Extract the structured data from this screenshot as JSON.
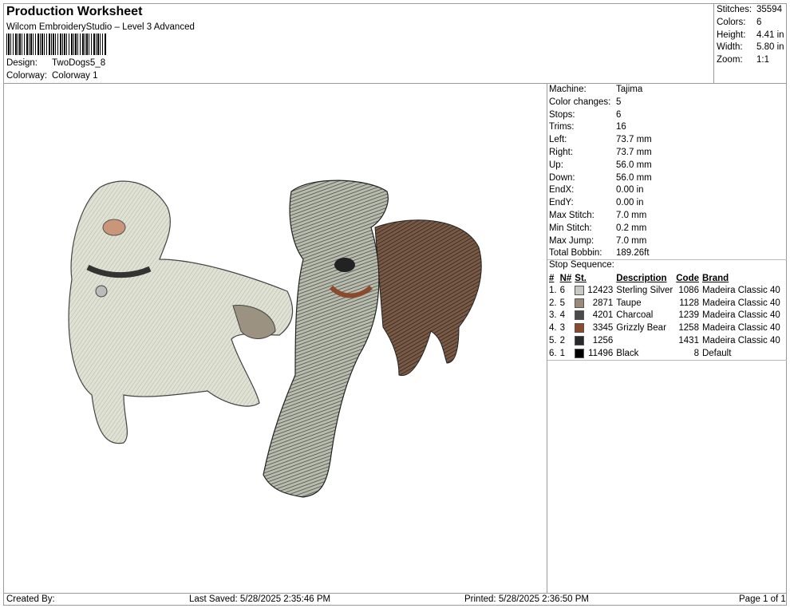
{
  "header": {
    "title": "Production Worksheet",
    "software": "Wilcom EmbroideryStudio – Level 3 Advanced",
    "design_label": "Design:",
    "design_value": "TwoDogs5_8",
    "colorway_label": "Colorway:",
    "colorway_value": "Colorway 1"
  },
  "summary": {
    "stitches_label": "Stitches:",
    "stitches_value": "35594",
    "colors_label": "Colors:",
    "colors_value": "6",
    "height_label": "Height:",
    "height_value": "4.41 in",
    "width_label": "Width:",
    "width_value": "5.80 in",
    "zoom_label": "Zoom:",
    "zoom_value": "1:1"
  },
  "machine_info": [
    {
      "label": "Machine:",
      "value": "Tajima"
    },
    {
      "label": "Color changes:",
      "value": "5"
    },
    {
      "label": "Stops:",
      "value": "6"
    },
    {
      "label": "Trims:",
      "value": "16"
    },
    {
      "label": "Left:",
      "value": "73.7 mm"
    },
    {
      "label": "Right:",
      "value": "73.7 mm"
    },
    {
      "label": "Up:",
      "value": "56.0 mm"
    },
    {
      "label": "Down:",
      "value": "56.0 mm"
    },
    {
      "label": "EndX:",
      "value": "0.00 in"
    },
    {
      "label": "EndY:",
      "value": "0.00 in"
    },
    {
      "label": "Max Stitch:",
      "value": "7.0 mm"
    },
    {
      "label": "Min Stitch:",
      "value": "0.2 mm"
    },
    {
      "label": "Max Jump:",
      "value": "7.0 mm"
    },
    {
      "label": "Total Bobbin:",
      "value": "189.26ft"
    }
  ],
  "stop_sequence": {
    "heading": "Stop Sequence:",
    "columns": [
      "#",
      "N#",
      "St.",
      "Description",
      "Code",
      "Brand"
    ],
    "rows": [
      {
        "idx": "1.",
        "n": "6",
        "color": "#c9c9c4",
        "st": "12423",
        "desc": "Sterling Silver",
        "code": "1086",
        "brand": "Madeira Classic 40"
      },
      {
        "idx": "2.",
        "n": "5",
        "color": "#9c8a78",
        "st": "2871",
        "desc": "Taupe",
        "code": "1128",
        "brand": "Madeira Classic 40"
      },
      {
        "idx": "3.",
        "n": "4",
        "color": "#4a4a4a",
        "st": "4201",
        "desc": "Charcoal",
        "code": "1239",
        "brand": "Madeira Classic 40"
      },
      {
        "idx": "4.",
        "n": "3",
        "color": "#8b4a2e",
        "st": "3345",
        "desc": "Grizzly Bear",
        "code": "1258",
        "brand": "Madeira Classic 40"
      },
      {
        "idx": "5.",
        "n": "2",
        "color": "#2a2a2a",
        "st": "1256",
        "desc": "",
        "code": "1431",
        "brand": "Madeira Classic 40"
      },
      {
        "idx": "6.",
        "n": "1",
        "color": "#000000",
        "st": "11496",
        "desc": "Black",
        "code": "8",
        "brand": "Default"
      }
    ]
  },
  "footer": {
    "created_by": "Created By:",
    "last_saved": "Last Saved: 5/28/2025 2:35:46 PM",
    "printed": "Printed: 5/28/2025 2:36:50 PM",
    "page": "Page 1 of 1"
  }
}
